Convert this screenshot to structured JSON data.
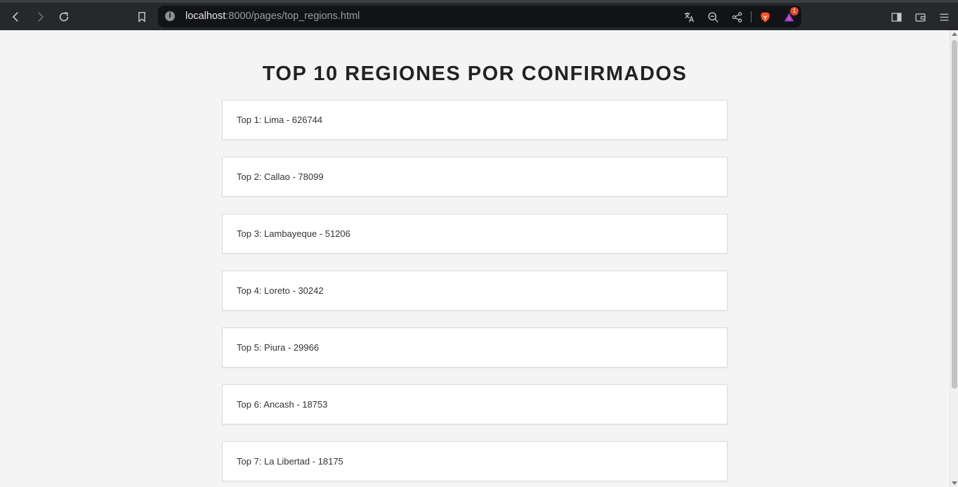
{
  "browser": {
    "url_host": "localhost",
    "url_path": ":8000/pages/top_regions.html",
    "notification_count": "1"
  },
  "page": {
    "title": "TOP 10 REGIONES POR CONFIRMADOS"
  },
  "regions": [
    {
      "text": "Top 1: Lima - 626744"
    },
    {
      "text": "Top 2: Callao - 78099"
    },
    {
      "text": "Top 3: Lambayeque - 51206"
    },
    {
      "text": "Top 4: Loreto - 30242"
    },
    {
      "text": "Top 5: Piura - 29966"
    },
    {
      "text": "Top 6: Ancash - 18753"
    },
    {
      "text": "Top 7: La Libertad - 18175"
    }
  ]
}
